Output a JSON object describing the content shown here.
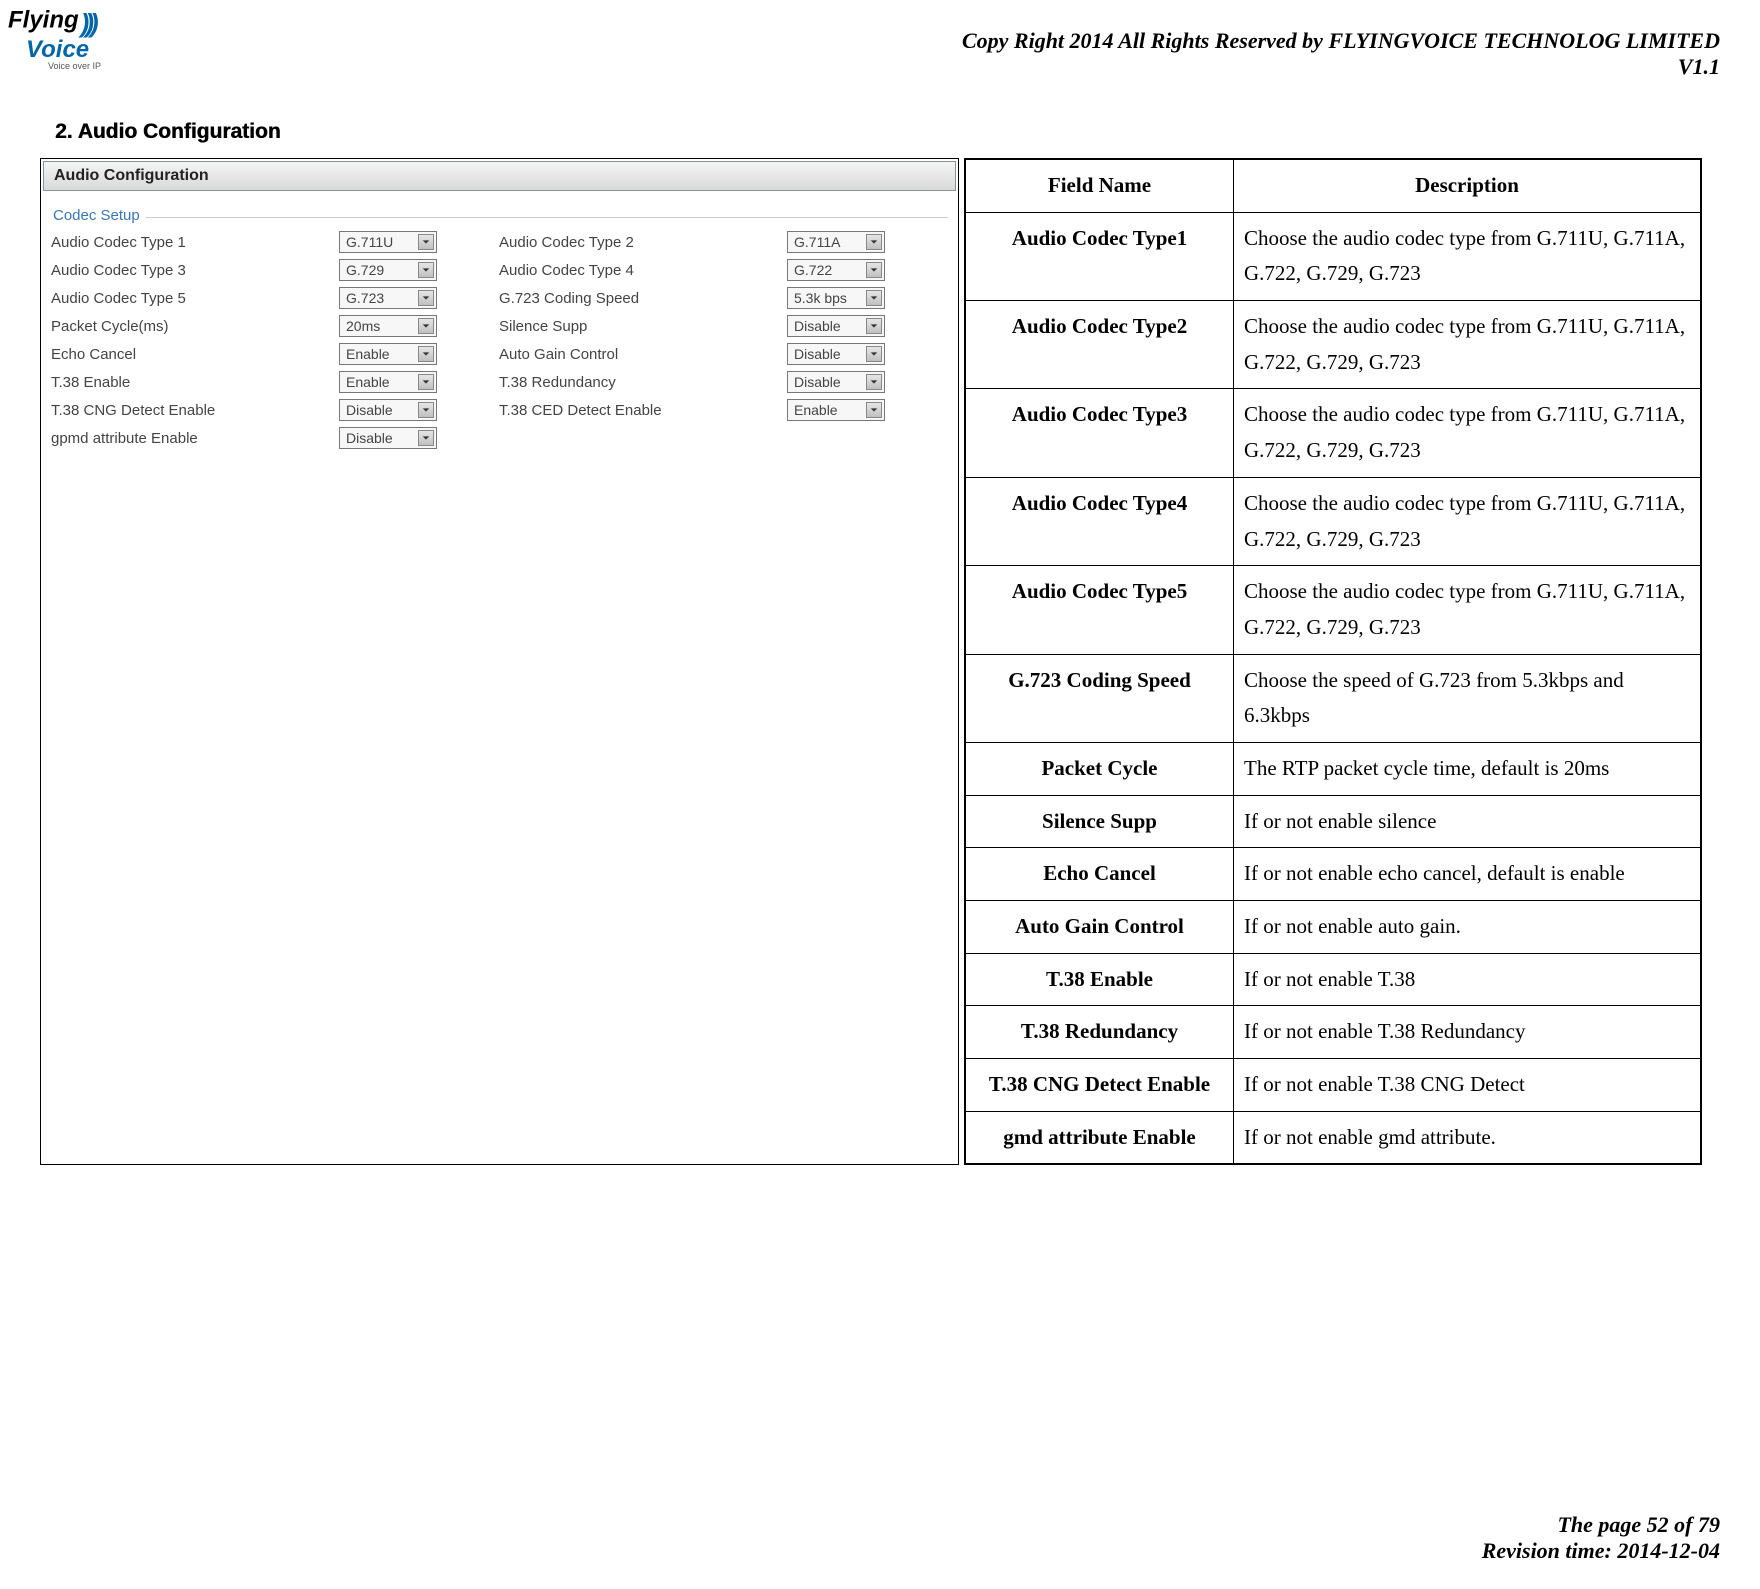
{
  "header": {
    "copyright": "Copy Right 2014 All Rights Reserved by FLYINGVOICE TECHNOLOG LIMITED",
    "version": "V1.1"
  },
  "logo": {
    "t1": "Flying",
    "t2": "Voice",
    "tagline": "Voice over IP"
  },
  "section": {
    "title": "2.  Audio Configuration"
  },
  "panel": {
    "title": "Audio Configuration",
    "legend": "Codec Setup",
    "rows": [
      {
        "l_label": "Audio Codec Type 1",
        "l_value": "G.711U",
        "r_label": "Audio Codec Type 2",
        "r_value": "G.711A"
      },
      {
        "l_label": "Audio Codec Type 3",
        "l_value": "G.729",
        "r_label": "Audio Codec Type 4",
        "r_value": "G.722"
      },
      {
        "l_label": "Audio Codec Type 5",
        "l_value": "G.723",
        "r_label": "G.723 Coding Speed",
        "r_value": "5.3k bps"
      },
      {
        "l_label": "Packet Cycle(ms)",
        "l_value": "20ms",
        "r_label": "Silence Supp",
        "r_value": "Disable"
      },
      {
        "l_label": "Echo Cancel",
        "l_value": "Enable",
        "r_label": "Auto Gain Control",
        "r_value": "Disable"
      },
      {
        "l_label": "T.38 Enable",
        "l_value": "Enable",
        "r_label": "T.38 Redundancy",
        "r_value": "Disable"
      },
      {
        "l_label": "T.38 CNG Detect Enable",
        "l_value": "Disable",
        "r_label": "T.38 CED Detect Enable",
        "r_value": "Enable"
      },
      {
        "l_label": "gpmd attribute Enable",
        "l_value": "Disable",
        "r_label": "",
        "r_value": ""
      }
    ]
  },
  "table": {
    "head_field": "Field Name",
    "head_desc": "Description",
    "rows": [
      {
        "field": "Audio Codec Type1",
        "desc": "Choose the audio codec type from G.711U, G.711A, G.722, G.729, G.723",
        "justify": true
      },
      {
        "field": "Audio Codec Type2",
        "desc": "Choose the audio codec type from G.711U, G.711A, G.722, G.729, G.723",
        "justify": true
      },
      {
        "field": "Audio Codec Type3",
        "desc": "Choose the audio codec type from G.711U, G.711A, G.722, G.729, G.723",
        "justify": true
      },
      {
        "field": "Audio Codec Type4",
        "desc": "Choose the audio codec type from G.711U, G.711A, G.722, G.729, G.723",
        "justify": true
      },
      {
        "field": "Audio Codec Type5",
        "desc": "Choose the audio codec type from G.711U, G.711A, G.722, G.729, G.723",
        "justify": true
      },
      {
        "field": "G.723 Coding Speed",
        "desc": "Choose the speed of G.723 from 5.3kbps and 6.3kbps",
        "justify": true
      },
      {
        "field": "Packet Cycle",
        "desc": "The RTP packet cycle time, default is 20ms",
        "justify": false
      },
      {
        "field": "Silence Supp",
        "desc": "If or not enable silence",
        "justify": false
      },
      {
        "field": "Echo Cancel",
        "desc": "If or not enable echo cancel, default is enable",
        "justify": false
      },
      {
        "field": "Auto Gain Control",
        "desc": "If or not enable auto gain.",
        "justify": false
      },
      {
        "field": "T.38 Enable",
        "desc": "If or not enable T.38",
        "justify": false
      },
      {
        "field": "T.38 Redundancy",
        "desc": "If or not enable T.38 Redundancy",
        "justify": false
      },
      {
        "field": "T.38 CNG Detect Enable",
        "desc": "If or not enable T.38 CNG Detect",
        "justify": false
      },
      {
        "field": "gmd attribute Enable",
        "desc": "If or not enable gmd attribute.",
        "justify": false
      }
    ]
  },
  "footer": {
    "page": "The page 52 of 79",
    "revision": "Revision time: 2014-12-04"
  }
}
